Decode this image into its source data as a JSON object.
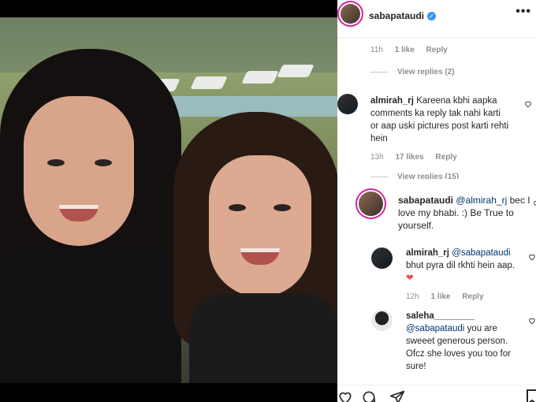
{
  "post": {
    "username": "sabapataudi",
    "more_icon": "more-icon"
  },
  "comments": [
    {
      "meta": {
        "time": "11h",
        "likes": "1 like",
        "reply": "Reply"
      },
      "view_replies": "View replies (2)"
    },
    {
      "username": "almirah_rj",
      "text": "Kareena kbhi aapka comments ka reply tak nahi karti or aap uski pictures post karti rehti hein",
      "meta": {
        "time": "13h",
        "likes": "17 likes",
        "reply": "Reply"
      },
      "view_replies": "View replies (15)"
    },
    {
      "username": "sabapataudi",
      "mention": "@almirah_rj",
      "text": "bec I love my bhabi. :) Be True to yourself."
    },
    {
      "username": "almirah_rj",
      "mention": "@sabapataudi",
      "text": "bhut pyra dil rkhti hein aap.",
      "meta": {
        "time": "12h",
        "likes": "1 like",
        "reply": "Reply"
      }
    },
    {
      "username": "saleha________",
      "mention": "@sabapataudi",
      "text": "you are sweeet generous person. Ofcz she loves you too for sure!"
    }
  ],
  "colors": {
    "accent": "#3897f0",
    "ring": "#d6249f",
    "heart": "#ed4956"
  }
}
